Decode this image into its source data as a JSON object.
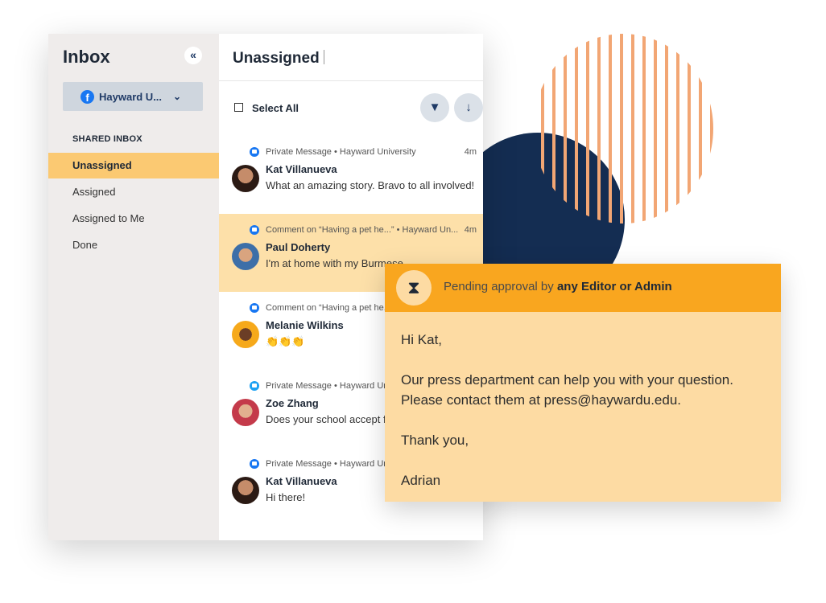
{
  "sidebar": {
    "title": "Inbox",
    "collapse_glyph": "«",
    "account": {
      "icon": "facebook-icon",
      "label": "Hayward U...",
      "chevron": "⌄"
    },
    "section_label": "SHARED INBOX",
    "items": [
      {
        "label": "Unassigned",
        "active": true
      },
      {
        "label": "Assigned",
        "active": false
      },
      {
        "label": "Assigned to Me",
        "active": false
      },
      {
        "label": "Done",
        "active": false
      }
    ]
  },
  "main": {
    "title": "Unassigned",
    "select_all_label": "Select All",
    "filter_glyph": "▼",
    "sort_glyph": "↓",
    "messages": [
      {
        "channel": "facebook",
        "meta": "Private Message • Hayward University",
        "time": "4m",
        "name": "Kat Villanueva",
        "text": "What an amazing story. Bravo to all involved!",
        "highlight": false
      },
      {
        "channel": "facebook",
        "meta": "Comment on “Having a pet he...” • Hayward Un...",
        "time": "4m",
        "name": "Paul Doherty",
        "text": "I'm at home with my Burmese",
        "highlight": true
      },
      {
        "channel": "facebook",
        "meta": "Comment on “Having a pet he...",
        "time": "",
        "name": "Melanie Wilkins",
        "text": "👏👏👏",
        "highlight": false
      },
      {
        "channel": "twitter",
        "meta": "Private Message • Hayward Uni",
        "time": "",
        "name": "Zoe Zhang",
        "text": "Does your school accept for",
        "highlight": false
      },
      {
        "channel": "facebook",
        "meta": "Private Message • Hayward Uni",
        "time": "",
        "name": "Kat Villanueva",
        "text": "Hi there!",
        "highlight": false
      }
    ]
  },
  "approval_card": {
    "icon": "hourglass-icon",
    "icon_glyph": "⧗",
    "pending_prefix": "Pending approval by ",
    "pending_bold": "any Editor or Admin",
    "lines": {
      "greeting": "Hi Kat,",
      "line1": "Our press department can help you with your question.",
      "line2": "Please contact them at press@haywardu.edu.",
      "thanks": "Thank you,",
      "signature": "Adrian"
    }
  },
  "colors": {
    "active_nav": "#fbc972",
    "highlight_row": "#fde0a9",
    "card_header": "#f9a61f",
    "card_body": "#fddba3",
    "navy": "#142d52",
    "stripe": "#f2a674"
  }
}
